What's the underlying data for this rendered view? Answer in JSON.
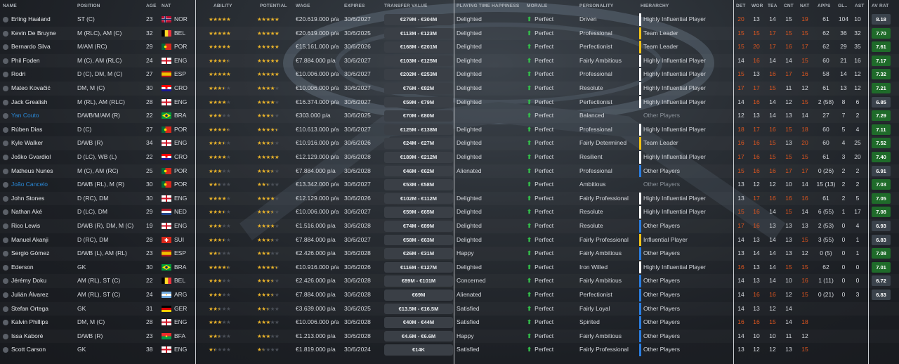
{
  "headers": {
    "name": "NAME",
    "position": "POSITION",
    "age": "AGE",
    "nat": "NAT",
    "ability": "ABILITY",
    "potential": "POTENTIAL",
    "wage": "WAGE",
    "expires": "EXPIRES",
    "transfer_value": "TRANSFER VALUE",
    "playing_time": "PLAYING TIME HAPPINESS",
    "morale": "MORALE",
    "personality": "PERSONALITY",
    "hierarchy": "HIERARCHY",
    "det": "DET",
    "wor": "WOR",
    "tea": "TEA",
    "cnt": "CNT",
    "natattr": "NAT",
    "apps": "APPS",
    "gls": "GL..",
    "ast": "AST",
    "avrat": "AV RAT"
  },
  "colors": {
    "star": "#e8b22b",
    "orange": "#e0561f",
    "green_arrow": "#33c24a",
    "loan_name": "#2a88d6"
  },
  "players": [
    {
      "name": "Erling Haaland",
      "pos": "ST (C)",
      "age": "23",
      "nat": "NOR",
      "ability": 5,
      "potential": 5,
      "wage": "€20.619.000 p/a",
      "expires": "30/6/2027",
      "tv": "€279M - €304M",
      "pth": "Delighted",
      "morale": "Perfect",
      "personality": "Driven",
      "hier": "Highly Influential Player",
      "hcol": "#ffffff",
      "det": "20",
      "wor": "13",
      "tea": "14",
      "cnt": "15",
      "natv": "19",
      "apps": "61",
      "gls": "104",
      "ast": "10",
      "rat": "8.18",
      "ratcol": "#3b434c",
      "loan": false,
      "orange": [
        "det",
        "natv"
      ]
    },
    {
      "name": "Kevin De Bruyne",
      "pos": "M (RLC), AM (C)",
      "age": "32",
      "nat": "BEL",
      "ability": 5,
      "potential": 5,
      "wage": "€20.619.000 p/a",
      "expires": "30/6/2025",
      "tv": "€113M - €123M",
      "pth": "Delighted",
      "morale": "Perfect",
      "personality": "Professional",
      "hier": "Team Leader",
      "hcol": "#f2c318",
      "det": "15",
      "wor": "15",
      "tea": "17",
      "cnt": "15",
      "natv": "15",
      "apps": "62",
      "gls": "36",
      "ast": "32",
      "rat": "7.70",
      "ratcol": "#1f6b2a",
      "loan": false,
      "orange": [
        "det",
        "wor",
        "tea",
        "cnt",
        "natv"
      ]
    },
    {
      "name": "Bernardo Silva",
      "pos": "M/AM (RC)",
      "age": "29",
      "nat": "POR",
      "ability": 5,
      "potential": 5,
      "wage": "€15.161.000 p/a",
      "expires": "30/6/2026",
      "tv": "€168M - €201M",
      "pth": "Delighted",
      "morale": "Perfect",
      "personality": "Perfectionist",
      "hier": "Team Leader",
      "hcol": "#f2c318",
      "det": "15",
      "wor": "20",
      "tea": "17",
      "cnt": "16",
      "natv": "17",
      "apps": "62",
      "gls": "29",
      "ast": "35",
      "rat": "7.61",
      "ratcol": "#1f6b2a",
      "loan": false,
      "orange": [
        "det",
        "wor",
        "tea",
        "cnt",
        "natv"
      ]
    },
    {
      "name": "Phil Foden",
      "pos": "M (C), AM (RLC)",
      "age": "24",
      "nat": "ENG",
      "ability": 4.5,
      "potential": 5,
      "wage": "€7.884.000 p/a",
      "expires": "30/6/2027",
      "tv": "€103M - €125M",
      "pth": "Delighted",
      "morale": "Perfect",
      "personality": "Fairly Ambitious",
      "hier": "Highly Influential Player",
      "hcol": "#ffffff",
      "det": "14",
      "wor": "16",
      "tea": "14",
      "cnt": "14",
      "natv": "15",
      "apps": "60",
      "gls": "21",
      "ast": "16",
      "rat": "7.17",
      "ratcol": "#1f6b2a",
      "loan": false,
      "orange": [
        "wor",
        "natv"
      ]
    },
    {
      "name": "Rodri",
      "pos": "D (C), DM, M (C)",
      "age": "27",
      "nat": "ESP",
      "ability": 5,
      "potential": 5,
      "wage": "€10.006.000 p/a",
      "expires": "30/6/2027",
      "tv": "€202M - €253M",
      "pth": "Delighted",
      "morale": "Perfect",
      "personality": "Professional",
      "hier": "Highly Influential Player",
      "hcol": "#ffffff",
      "det": "15",
      "wor": "13",
      "tea": "16",
      "cnt": "17",
      "natv": "16",
      "apps": "58",
      "gls": "14",
      "ast": "12",
      "rat": "7.32",
      "ratcol": "#1f6b2a",
      "loan": false,
      "orange": [
        "det",
        "tea",
        "cnt",
        "natv"
      ]
    },
    {
      "name": "Mateo Kovačić",
      "pos": "DM, M (C)",
      "age": "30",
      "nat": "CRO",
      "ability": 3.5,
      "potential": 4,
      "wage": "€10.006.000 p/a",
      "expires": "30/6/2027",
      "tv": "€76M - €82M",
      "pth": "Delighted",
      "morale": "Perfect",
      "personality": "Resolute",
      "hier": "Highly Influential Player",
      "hcol": "#ffffff",
      "det": "17",
      "wor": "17",
      "tea": "15",
      "cnt": "11",
      "natv": "12",
      "apps": "61",
      "gls": "13",
      "ast": "12",
      "rat": "7.21",
      "ratcol": "#1f6b2a",
      "loan": false,
      "orange": [
        "det",
        "wor",
        "tea"
      ]
    },
    {
      "name": "Jack Grealish",
      "pos": "M (RL), AM (RLC)",
      "age": "28",
      "nat": "ENG",
      "ability": 4,
      "potential": 4,
      "wage": "€16.374.000 p/a",
      "expires": "30/6/2027",
      "tv": "€59M - €79M",
      "pth": "Delighted",
      "morale": "Perfect",
      "personality": "Perfectionist",
      "hier": "Highly Influential Player",
      "hcol": "#ffffff",
      "det": "14",
      "wor": "16",
      "tea": "14",
      "cnt": "12",
      "natv": "15",
      "apps": "2 (58)",
      "gls": "8",
      "ast": "6",
      "rat": "6.85",
      "ratcol": "#3b434c",
      "loan": false,
      "orange": [
        "wor",
        "natv"
      ]
    },
    {
      "name": "Yan Couto",
      "pos": "D/WB/M/AM (R)",
      "age": "22",
      "nat": "BRA",
      "ability": 3,
      "potential": 3.5,
      "wage": "€303.000 p/a",
      "expires": "30/6/2025",
      "tv": "€70M - €80M",
      "pth": "",
      "morale": "Perfect",
      "personality": "Balanced",
      "hier": "Other Players",
      "hcol": "",
      "det": "12",
      "wor": "13",
      "tea": "14",
      "cnt": "13",
      "natv": "14",
      "apps": "27",
      "gls": "7",
      "ast": "2",
      "rat": "7.29",
      "ratcol": "#1f6b2a",
      "loan": true,
      "orange": []
    },
    {
      "name": "Rúben Dias",
      "pos": "D (C)",
      "age": "27",
      "nat": "POR",
      "ability": 4.5,
      "potential": 4.5,
      "wage": "€10.613.000 p/a",
      "expires": "30/6/2027",
      "tv": "€125M - €138M",
      "pth": "Delighted",
      "morale": "Perfect",
      "personality": "Professional",
      "hier": "Highly Influential Player",
      "hcol": "#ffffff",
      "det": "18",
      "wor": "17",
      "tea": "16",
      "cnt": "15",
      "natv": "18",
      "apps": "60",
      "gls": "5",
      "ast": "4",
      "rat": "7.11",
      "ratcol": "#1f6b2a",
      "loan": false,
      "orange": [
        "det",
        "wor",
        "tea",
        "cnt",
        "natv"
      ]
    },
    {
      "name": "Kyle Walker",
      "pos": "D/WB (R)",
      "age": "34",
      "nat": "ENG",
      "ability": 3.5,
      "potential": 3.5,
      "wage": "€10.916.000 p/a",
      "expires": "30/6/2026",
      "tv": "€24M - €27M",
      "pth": "Delighted",
      "morale": "Perfect",
      "personality": "Fairly Determined",
      "hier": "Team Leader",
      "hcol": "#f2c318",
      "det": "16",
      "wor": "16",
      "tea": "15",
      "cnt": "13",
      "natv": "20",
      "apps": "60",
      "gls": "4",
      "ast": "25",
      "rat": "7.52",
      "ratcol": "#1f6b2a",
      "loan": false,
      "orange": [
        "det",
        "wor",
        "tea",
        "natv"
      ]
    },
    {
      "name": "Joško Gvardiol",
      "pos": "D (LC), WB (L)",
      "age": "22",
      "nat": "CRO",
      "ability": 4,
      "potential": 5,
      "wage": "€12.129.000 p/a",
      "expires": "30/6/2028",
      "tv": "€189M - €212M",
      "pth": "Delighted",
      "morale": "Perfect",
      "personality": "Resilient",
      "hier": "Highly Influential Player",
      "hcol": "#ffffff",
      "det": "17",
      "wor": "16",
      "tea": "15",
      "cnt": "15",
      "natv": "15",
      "apps": "61",
      "gls": "3",
      "ast": "20",
      "rat": "7.40",
      "ratcol": "#1f6b2a",
      "loan": false,
      "orange": [
        "det",
        "wor",
        "tea",
        "cnt",
        "natv"
      ]
    },
    {
      "name": "Matheus Nunes",
      "pos": "M (C), AM (RC)",
      "age": "25",
      "nat": "POR",
      "ability": 3,
      "potential": 3.5,
      "wage": "€7.884.000 p/a",
      "expires": "30/6/2028",
      "tv": "€46M - €62M",
      "pth": "Alienated",
      "morale": "Perfect",
      "personality": "Professional",
      "hier": "Other Players",
      "hcol": "#2a7de0",
      "det": "15",
      "wor": "16",
      "tea": "16",
      "cnt": "17",
      "natv": "17",
      "apps": "0 (26)",
      "gls": "2",
      "ast": "2",
      "rat": "6.91",
      "ratcol": "#3b434c",
      "loan": false,
      "orange": [
        "det",
        "wor",
        "tea",
        "cnt",
        "natv"
      ]
    },
    {
      "name": "João Cancelo",
      "pos": "D/WB (RL), M (R)",
      "age": "30",
      "nat": "POR",
      "ability": 2.5,
      "potential": 2.5,
      "wage": "€13.342.000 p/a",
      "expires": "30/6/2027",
      "tv": "€53M - €58M",
      "pth": "",
      "morale": "Perfect",
      "personality": "Ambitious",
      "hier": "Other Players",
      "hcol": "",
      "det": "13",
      "wor": "12",
      "tea": "12",
      "cnt": "10",
      "natv": "14",
      "apps": "15 (13)",
      "gls": "2",
      "ast": "2",
      "rat": "7.03",
      "ratcol": "#1f6b2a",
      "loan": true,
      "orange": []
    },
    {
      "name": "John Stones",
      "pos": "D (RC), DM",
      "age": "30",
      "nat": "ENG",
      "ability": 4,
      "potential": 4,
      "wage": "€12.129.000 p/a",
      "expires": "30/6/2026",
      "tv": "€102M - €112M",
      "pth": "Delighted",
      "morale": "Perfect",
      "personality": "Fairly Professional",
      "hier": "Highly Influential Player",
      "hcol": "#ffffff",
      "det": "13",
      "wor": "17",
      "tea": "16",
      "cnt": "16",
      "natv": "16",
      "apps": "61",
      "gls": "2",
      "ast": "5",
      "rat": "7.05",
      "ratcol": "#1f6b2a",
      "loan": false,
      "orange": [
        "wor",
        "tea",
        "cnt",
        "natv"
      ]
    },
    {
      "name": "Nathan Aké",
      "pos": "D (LC), DM",
      "age": "29",
      "nat": "NED",
      "ability": 3.5,
      "potential": 3.5,
      "wage": "€10.006.000 p/a",
      "expires": "30/6/2027",
      "tv": "€59M - €65M",
      "pth": "Delighted",
      "morale": "Perfect",
      "personality": "Resolute",
      "hier": "Highly Influential Player",
      "hcol": "#ffffff",
      "det": "15",
      "wor": "16",
      "tea": "14",
      "cnt": "15",
      "natv": "14",
      "apps": "6 (55)",
      "gls": "1",
      "ast": "17",
      "rat": "7.08",
      "ratcol": "#1f6b2a",
      "loan": false,
      "orange": [
        "det",
        "wor",
        "cnt"
      ]
    },
    {
      "name": "Rico Lewis",
      "pos": "D/WB (R), DM, M (C)",
      "age": "19",
      "nat": "ENG",
      "ability": 3,
      "potential": 4,
      "wage": "€1.516.000 p/a",
      "expires": "30/6/2028",
      "tv": "€74M - €89M",
      "pth": "Delighted",
      "morale": "Perfect",
      "personality": "Resolute",
      "hier": "Other Players",
      "hcol": "#2a7de0",
      "det": "17",
      "wor": "16",
      "tea": "13",
      "cnt": "13",
      "natv": "13",
      "apps": "2 (53)",
      "gls": "0",
      "ast": "4",
      "rat": "6.93",
      "ratcol": "#3b434c",
      "loan": false,
      "orange": [
        "det",
        "wor"
      ]
    },
    {
      "name": "Manuel Akanji",
      "pos": "D (RC), DM",
      "age": "28",
      "nat": "SUI",
      "ability": 3.5,
      "potential": 3.5,
      "wage": "€7.884.000 p/a",
      "expires": "30/6/2027",
      "tv": "€58M - €63M",
      "pth": "Delighted",
      "morale": "Perfect",
      "personality": "Fairly Professional",
      "hier": "Influential Player",
      "hcol": "#f2c318",
      "det": "14",
      "wor": "13",
      "tea": "14",
      "cnt": "13",
      "natv": "15",
      "apps": "3 (55)",
      "gls": "0",
      "ast": "1",
      "rat": "6.83",
      "ratcol": "#3b434c",
      "loan": false,
      "orange": [
        "natv"
      ]
    },
    {
      "name": "Sergio Gómez",
      "pos": "D/WB (L), AM (RL)",
      "age": "23",
      "nat": "ESP",
      "ability": 2.5,
      "potential": 3,
      "wage": "€2.426.000 p/a",
      "expires": "30/6/2028",
      "tv": "€26M - €31M",
      "pth": "Happy",
      "morale": "Perfect",
      "personality": "Fairly Ambitious",
      "hier": "Other Players",
      "hcol": "#2a7de0",
      "det": "13",
      "wor": "14",
      "tea": "14",
      "cnt": "13",
      "natv": "12",
      "apps": "0 (5)",
      "gls": "0",
      "ast": "1",
      "rat": "7.08",
      "ratcol": "#1f6b2a",
      "loan": false,
      "orange": []
    },
    {
      "name": "Ederson",
      "pos": "GK",
      "age": "30",
      "nat": "BRA",
      "ability": 4.5,
      "potential": 4.5,
      "wage": "€10.916.000 p/a",
      "expires": "30/6/2026",
      "tv": "€116M - €127M",
      "pth": "Delighted",
      "morale": "Perfect",
      "personality": "Iron Willed",
      "hier": "Highly Influential Player",
      "hcol": "#ffffff",
      "det": "16",
      "wor": "13",
      "tea": "14",
      "cnt": "15",
      "natv": "15",
      "apps": "62",
      "gls": "0",
      "ast": "0",
      "rat": "7.01",
      "ratcol": "#1f6b2a",
      "loan": false,
      "orange": [
        "det",
        "cnt",
        "natv"
      ]
    },
    {
      "name": "Jérémy Doku",
      "pos": "AM (RL), ST (C)",
      "age": "22",
      "nat": "BEL",
      "ability": 3,
      "potential": 3.5,
      "wage": "€2.426.000 p/a",
      "expires": "30/6/2028",
      "tv": "€89M - €101M",
      "pth": "Concerned",
      "morale": "Perfect",
      "personality": "Fairly Ambitious",
      "hier": "Other Players",
      "hcol": "#2a7de0",
      "det": "14",
      "wor": "13",
      "tea": "14",
      "cnt": "10",
      "natv": "16",
      "apps": "1 (11)",
      "gls": "0",
      "ast": "0",
      "rat": "6.72",
      "ratcol": "#3b434c",
      "loan": false,
      "orange": [
        "natv"
      ]
    },
    {
      "name": "Julián Álvarez",
      "pos": "AM (RL), ST (C)",
      "age": "24",
      "nat": "ARG",
      "ability": 3,
      "potential": 3.5,
      "wage": "€7.884.000 p/a",
      "expires": "30/6/2028",
      "tv": "€69M",
      "pth": "Alienated",
      "morale": "Perfect",
      "personality": "Perfectionist",
      "hier": "Other Players",
      "hcol": "#2a7de0",
      "det": "14",
      "wor": "16",
      "tea": "16",
      "cnt": "12",
      "natv": "15",
      "apps": "0 (21)",
      "gls": "0",
      "ast": "3",
      "rat": "6.83",
      "ratcol": "#3b434c",
      "loan": false,
      "orange": [
        "wor",
        "tea",
        "natv"
      ]
    },
    {
      "name": "Stefan Ortega",
      "pos": "GK",
      "age": "31",
      "nat": "GER",
      "ability": 2.5,
      "potential": 2.5,
      "wage": "€3.639.000 p/a",
      "expires": "30/6/2025",
      "tv": "€13.5M - €16.5M",
      "pth": "Satisfied",
      "morale": "Perfect",
      "personality": "Fairly Loyal",
      "hier": "Other Players",
      "hcol": "#2a7de0",
      "det": "14",
      "wor": "13",
      "tea": "12",
      "cnt": "14",
      "natv": "",
      "apps": "",
      "gls": "",
      "ast": "",
      "rat": "",
      "ratcol": "",
      "loan": false,
      "orange": []
    },
    {
      "name": "Kalvin Phillips",
      "pos": "DM, M (C)",
      "age": "28",
      "nat": "ENG",
      "ability": 3,
      "potential": 3,
      "wage": "€10.006.000 p/a",
      "expires": "30/6/2028",
      "tv": "€40M - €44M",
      "pth": "Satisfied",
      "morale": "Perfect",
      "personality": "Spirited",
      "hier": "Other Players",
      "hcol": "#2a7de0",
      "det": "16",
      "wor": "16",
      "tea": "15",
      "cnt": "14",
      "natv": "18",
      "apps": "",
      "gls": "",
      "ast": "",
      "rat": "",
      "ratcol": "",
      "loan": false,
      "orange": [
        "det",
        "wor",
        "tea",
        "natv"
      ]
    },
    {
      "name": "Issa Kaboré",
      "pos": "D/WB (R)",
      "age": "23",
      "nat": "BFA",
      "ability": 2.5,
      "potential": 3,
      "wage": "€1.213.000 p/a",
      "expires": "30/6/2028",
      "tv": "€4.6M - €6.6M",
      "pth": "Happy",
      "morale": "Perfect",
      "personality": "Fairly Ambitious",
      "hier": "Other Players",
      "hcol": "#2a7de0",
      "det": "14",
      "wor": "10",
      "tea": "10",
      "cnt": "11",
      "natv": "12",
      "apps": "",
      "gls": "",
      "ast": "",
      "rat": "",
      "ratcol": "",
      "loan": false,
      "orange": []
    },
    {
      "name": "Scott Carson",
      "pos": "GK",
      "age": "38",
      "nat": "ENG",
      "ability": 1.5,
      "potential": 1.5,
      "wage": "€1.819.000 p/a",
      "expires": "30/6/2024",
      "tv": "€14K",
      "pth": "Satisfied",
      "morale": "Perfect",
      "personality": "Fairly Professional",
      "hier": "Other Players",
      "hcol": "#2a7de0",
      "det": "13",
      "wor": "12",
      "tea": "12",
      "cnt": "13",
      "natv": "15",
      "apps": "",
      "gls": "",
      "ast": "",
      "rat": "",
      "ratcol": "",
      "loan": false,
      "orange": [
        "natv"
      ]
    }
  ]
}
